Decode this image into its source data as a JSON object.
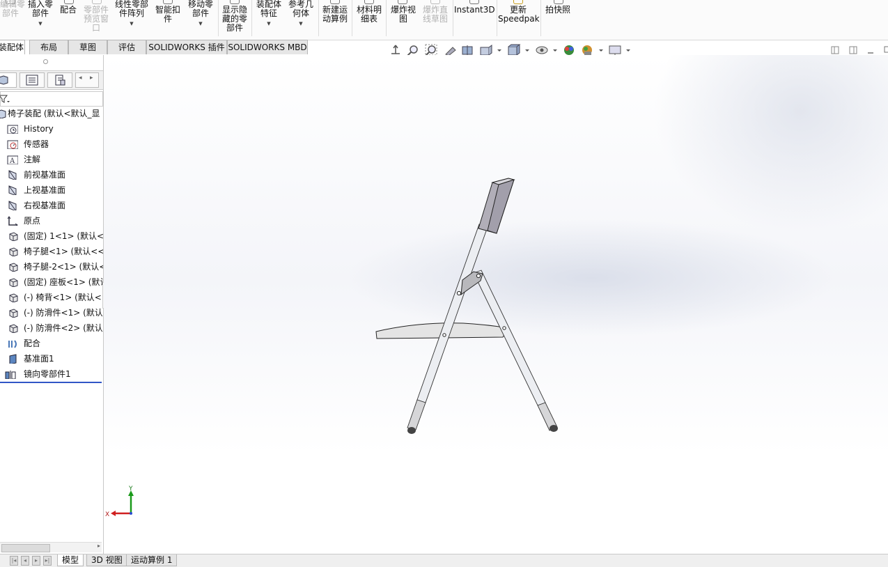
{
  "ribbon": {
    "buttons": [
      {
        "label": "编辑零\n部件",
        "dim": true
      },
      {
        "label": "插入零\n部件",
        "dim": false,
        "arrow": true
      },
      {
        "label": "配合",
        "dim": false
      },
      {
        "label": "零部件\n预览窗\n口",
        "dim": true
      },
      {
        "label": "线性零部\n件阵列",
        "dim": false,
        "arrow": true
      },
      {
        "label": "智能扣\n件",
        "dim": false
      },
      {
        "label": "移动零\n部件",
        "dim": false,
        "arrow": true
      },
      {
        "label": "显示隐\n藏的零\n部件",
        "dim": false
      },
      {
        "label": "装配体\n特征",
        "dim": false,
        "arrow": true
      },
      {
        "label": "参考几\n何体",
        "dim": false,
        "arrow": true
      },
      {
        "label": "新建运\n动算例",
        "dim": false
      },
      {
        "label": "材料明\n细表",
        "dim": false
      },
      {
        "label": "爆炸视\n图",
        "dim": false
      },
      {
        "label": "爆炸直\n线草图",
        "dim": true
      },
      {
        "label": "Instant3D",
        "dim": false
      },
      {
        "label": "更新\nSpeedpak",
        "dim": false
      },
      {
        "label": "拍快照",
        "dim": false
      }
    ]
  },
  "command_tabs": [
    "装配体",
    "布局",
    "草图",
    "评估",
    "SOLIDWORKS 插件",
    "SOLIDWORKS MBD"
  ],
  "active_tab": "装配体",
  "feature_tree": {
    "root": "椅子装配 (默认<默认_显",
    "items": [
      {
        "label": "History",
        "icon": "history-folder-icon"
      },
      {
        "label": "传感器",
        "icon": "sensor-icon"
      },
      {
        "label": "注解",
        "icon": "annotation-icon"
      },
      {
        "label": "前视基准面",
        "icon": "plane-icon"
      },
      {
        "label": "上视基准面",
        "icon": "plane-icon"
      },
      {
        "label": "右视基准面",
        "icon": "plane-icon"
      },
      {
        "label": "原点",
        "icon": "origin-icon"
      },
      {
        "label": "(固定) 1<1> (默认<<",
        "icon": "part-icon"
      },
      {
        "label": "椅子腿<1> (默认<<",
        "icon": "part-icon"
      },
      {
        "label": "椅子腿-2<1> (默认<",
        "icon": "part-icon"
      },
      {
        "label": "(固定) 座板<1> (默认",
        "icon": "part-icon"
      },
      {
        "label": "(-) 椅背<1> (默认<<",
        "icon": "part-icon"
      },
      {
        "label": "(-) 防滑件<1> (默认",
        "icon": "part-icon"
      },
      {
        "label": "(-) 防滑件<2> (默认",
        "icon": "part-icon"
      },
      {
        "label": "配合",
        "icon": "mates-icon"
      },
      {
        "label": "基准面1",
        "icon": "plane1-icon"
      },
      {
        "label": "镜向零部件1",
        "icon": "mirror-component-icon"
      }
    ]
  },
  "triad": {
    "x_label": "X",
    "y_label": "Y"
  },
  "bottom_tabs": [
    "模型",
    "3D 视图",
    "运动算例 1"
  ],
  "active_bottom_tab": "模型",
  "colors": {
    "selection_line": "#3156c6",
    "triad_x": "#d02020",
    "triad_y": "#1a9a1a"
  }
}
